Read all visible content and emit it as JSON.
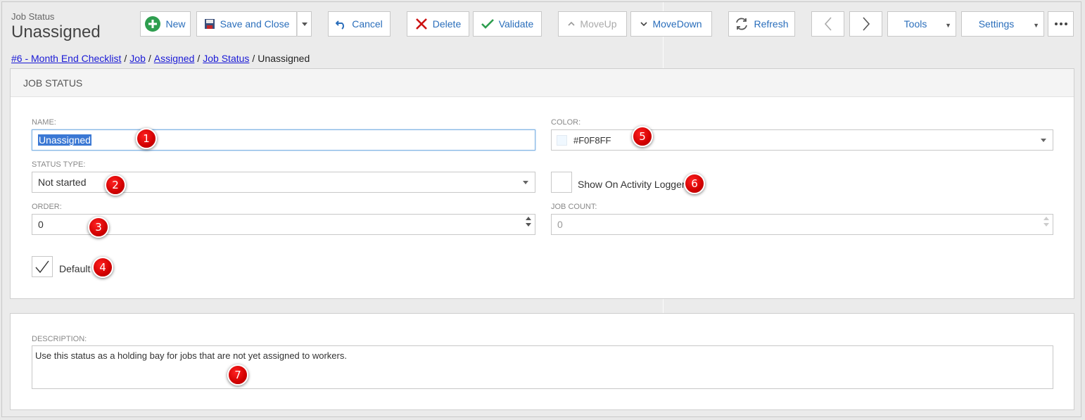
{
  "header": {
    "entity": "Job Status",
    "title": "Unassigned"
  },
  "toolbar": {
    "new": "New",
    "save_close": "Save and Close",
    "cancel": "Cancel",
    "delete": "Delete",
    "validate": "Validate",
    "move_up": "MoveUp",
    "move_down": "MoveDown",
    "refresh": "Refresh",
    "tools": "Tools",
    "settings": "Settings"
  },
  "breadcrumb": {
    "items": [
      "#6 - Month End Checklist",
      "Job",
      "Assigned",
      "Job Status"
    ],
    "current": "Unassigned"
  },
  "panel": {
    "title": "JOB STATUS"
  },
  "form": {
    "name_label": "NAME:",
    "name_value": "Unassigned",
    "status_type_label": "STATUS TYPE:",
    "status_type_value": "Not started",
    "order_label": "ORDER:",
    "order_value": "0",
    "default_label": "Default",
    "color_label": "COLOR:",
    "color_value": "#F0F8FF",
    "show_logger_label": "Show On Activity Logger",
    "job_count_label": "JOB COUNT:",
    "job_count_value": "0",
    "description_label": "DESCRIPTION:",
    "description_value": "Use this status as a holding bay for jobs that are not yet assigned to workers."
  },
  "markers": [
    "1",
    "2",
    "3",
    "4",
    "5",
    "6",
    "7"
  ],
  "colors": {
    "accent": "#2a6ebb",
    "new_icon": "#2e9e4f",
    "delete_icon": "#cc1111",
    "validate_icon": "#2e9e4f",
    "marker": "#d10000",
    "swatch": "#F0F8FF"
  }
}
